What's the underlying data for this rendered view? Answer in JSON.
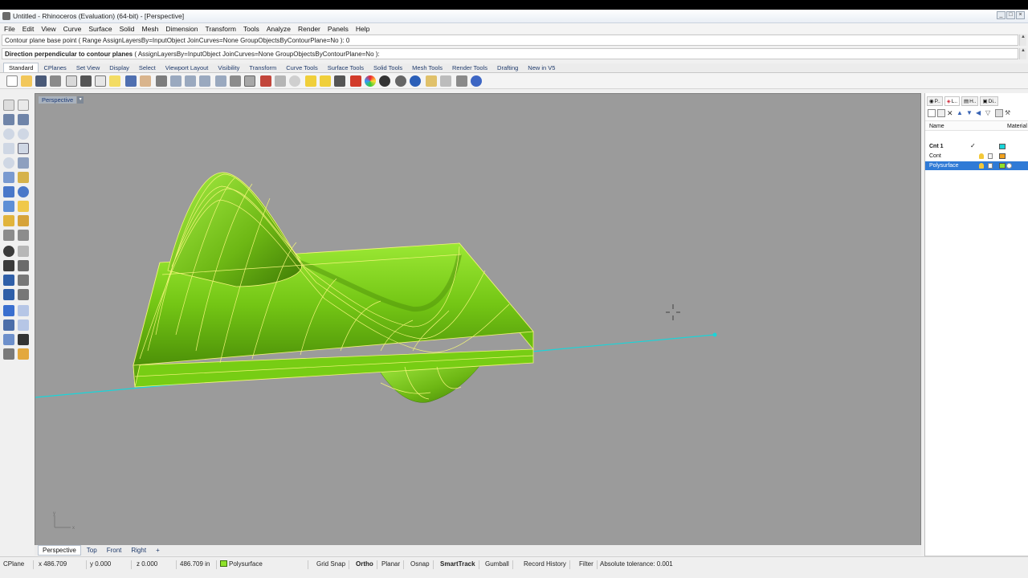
{
  "window": {
    "title": "Untitled - Rhinoceros (Evaluation) (64-bit) - [Perspective]",
    "buttons": [
      "_",
      "□",
      "×"
    ]
  },
  "menu": [
    "File",
    "Edit",
    "View",
    "Curve",
    "Surface",
    "Solid",
    "Mesh",
    "Dimension",
    "Transform",
    "Tools",
    "Analyze",
    "Render",
    "Panels",
    "Help"
  ],
  "command": {
    "history": "Contour plane base point ( Range  AssignLayersBy=InputObject  JoinCurves=None  GroupObjectsByContourPlane=No ): 0",
    "prompt_lead": "Direction perpendicular to contour planes",
    "prompt_options": "( AssignLayersBy=InputObject  JoinCurves=None  GroupObjectsByContourPlane=No ):"
  },
  "toolbar_tabs": [
    "Standard",
    "CPlanes",
    "Set View",
    "Display",
    "Select",
    "Viewport Layout",
    "Visibility",
    "Transform",
    "Curve Tools",
    "Surface Tools",
    "Solid Tools",
    "Mesh Tools",
    "Render Tools",
    "Drafting",
    "New in V5"
  ],
  "viewport": {
    "title": "Perspective",
    "axis_x": "x",
    "axis_y": "y"
  },
  "layers_panel": {
    "tabs": [
      "P..",
      "L..",
      "H..",
      "Di.."
    ],
    "col_name": "Name",
    "col_material": "Material",
    "rows": [
      {
        "name": "Cnt 1",
        "checked": "✓",
        "color": "#19d5d9"
      },
      {
        "name": "Cont",
        "checked": "",
        "color": "#f0a11e"
      },
      {
        "name": "Polysurface",
        "checked": "",
        "color": "#8fe22a"
      }
    ]
  },
  "viewport_tabs": [
    "Perspective",
    "Top",
    "Front",
    "Right",
    "+"
  ],
  "status": {
    "cplane": "CPlane",
    "x": "x 486.709",
    "y": "y 0.000",
    "z": "z 0.000",
    "distance": "486.709 in",
    "layer": "Polysurface",
    "grid_snap": "Grid Snap",
    "ortho": "Ortho",
    "planar": "Planar",
    "osnap": "Osnap",
    "smarttrack": "SmartTrack",
    "gumball": "Gumball",
    "record_history": "Record History",
    "filter": "Filter",
    "tolerance": "Absolute tolerance: 0.001"
  },
  "colors": {
    "surface": "#8fe22a",
    "wire": "#f3f57a",
    "contour_line": "#19d5d9",
    "viewport_bg": "#9b9b9b",
    "selection": "#2f7ad6"
  }
}
